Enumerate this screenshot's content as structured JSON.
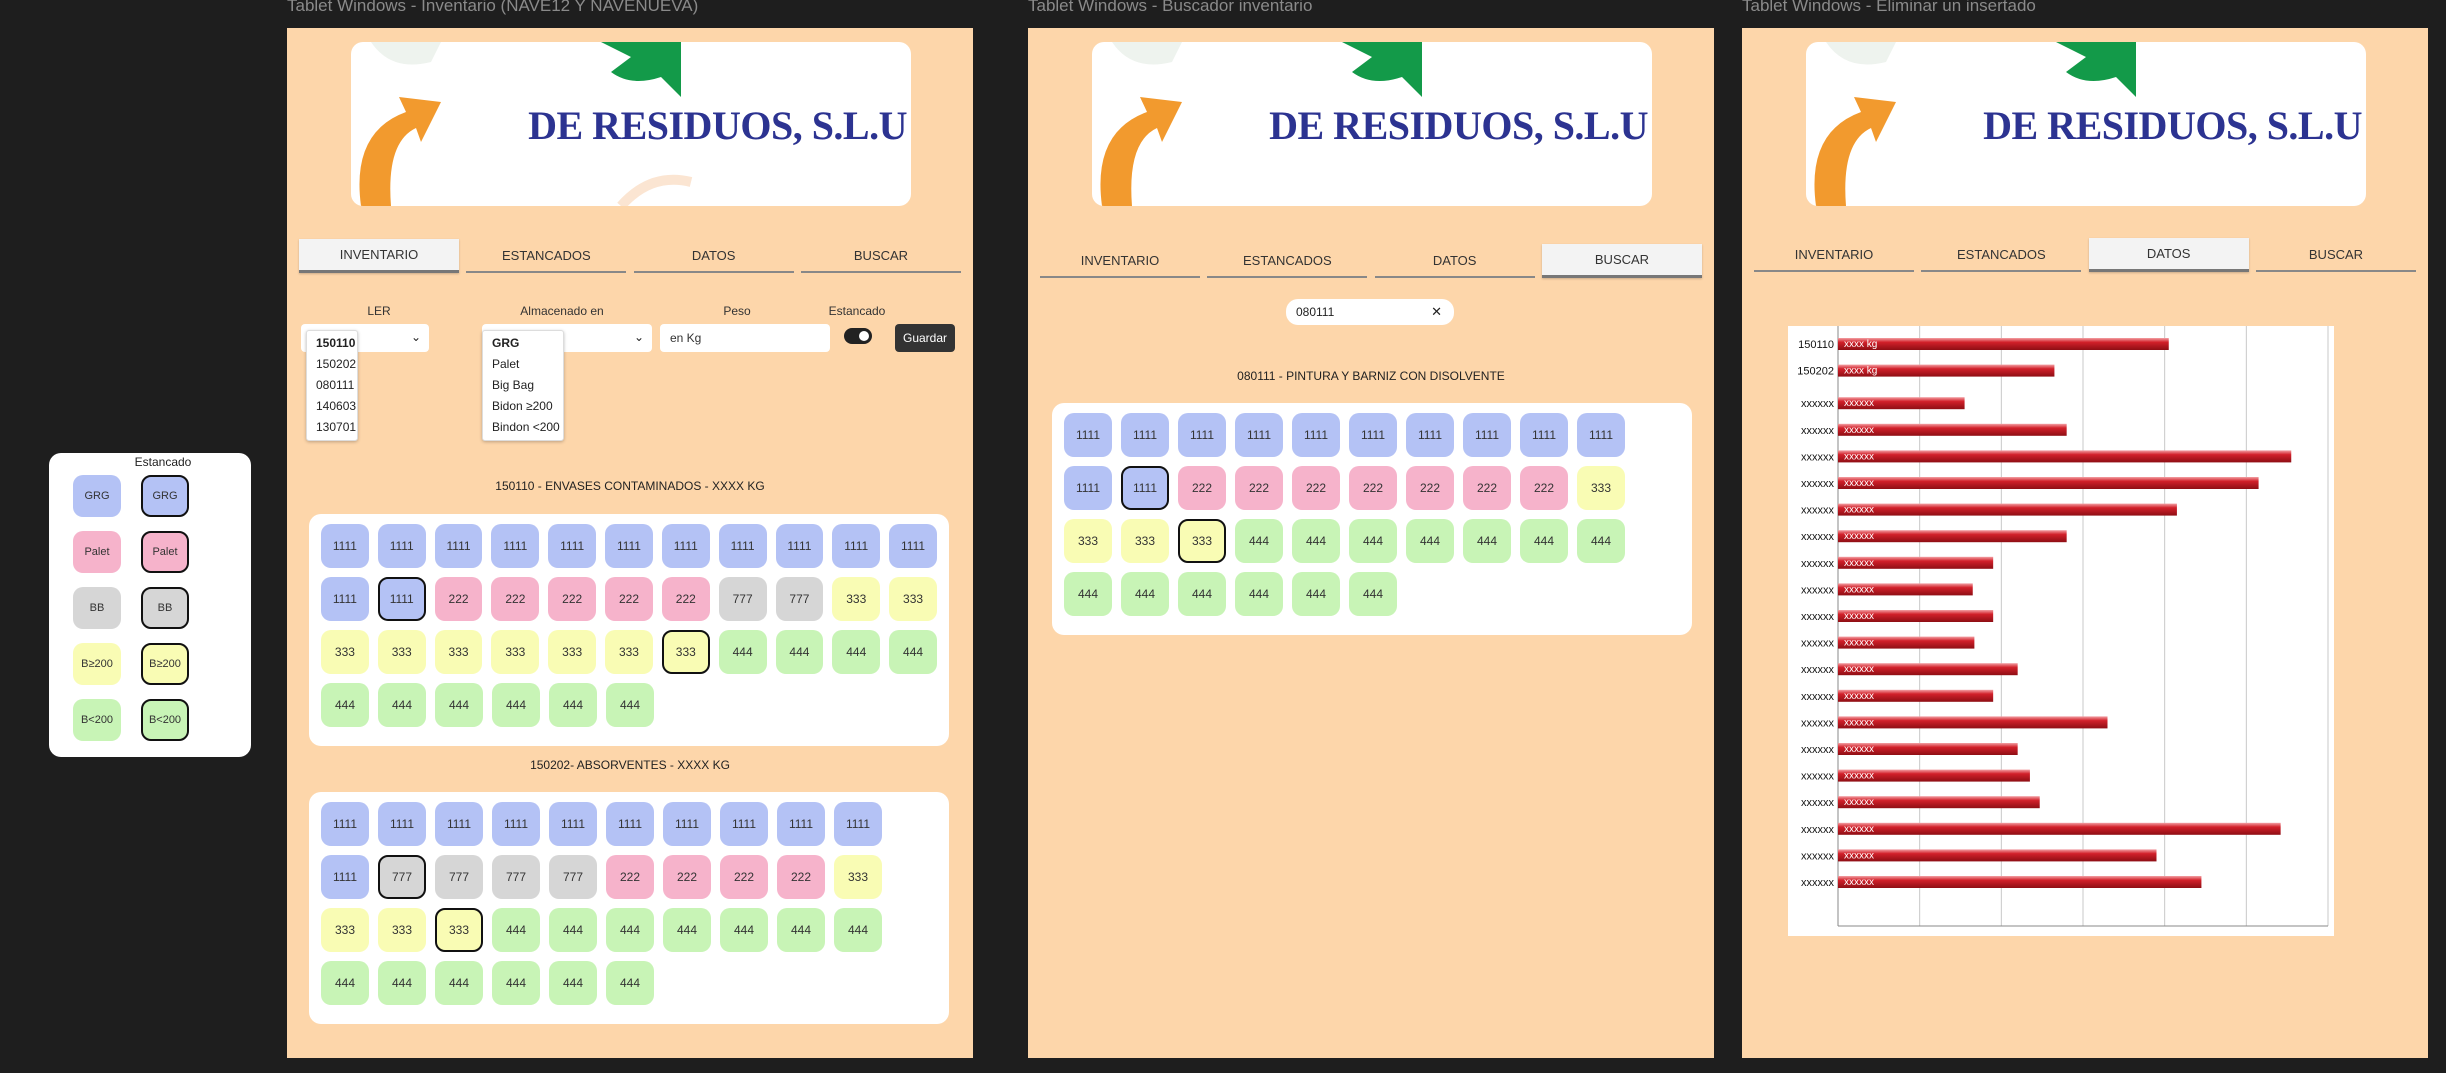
{
  "frames": [
    {
      "title": "Tablet Windows - Inventario (NAVE12 Y NAVENUEVA)"
    },
    {
      "title": "Tablet Windows - Buscador inventario"
    },
    {
      "title": "Tablet Windows - Eliminar un insertado"
    }
  ],
  "logo_text": "DE RESIDUOS, S.L.U",
  "tabs": [
    "INVENTARIO",
    "ESTANCADOS",
    "DATOS",
    "BUSCAR"
  ],
  "form": {
    "ler_label": "LER",
    "almacen_label": "Almacenado en",
    "peso_label": "Peso",
    "estancado_label": "Estancado",
    "peso_placeholder": "en Kg",
    "guardar": "Guardar",
    "ler_options": [
      "150110",
      "150202",
      "080111",
      "140603",
      "130701"
    ],
    "almacen_options": [
      "GRG",
      "Palet",
      "Big Bag",
      "Bidon ≥200",
      "Bindon <200"
    ]
  },
  "legend": {
    "title": "Estancado",
    "rows": [
      [
        "GRG",
        "GRG"
      ],
      [
        "Palet",
        "Palet"
      ],
      [
        "BB",
        "BB"
      ],
      [
        "B≥200",
        "B≥200"
      ],
      [
        "B<200",
        "B<200"
      ]
    ]
  },
  "inventory": {
    "sec1_title": "150110 - ENVASES CONTAMINADOS - XXXX KG",
    "sec1": [
      [
        [
          "1111",
          "b"
        ],
        [
          "1111",
          "b"
        ],
        [
          "1111",
          "b"
        ],
        [
          "1111",
          "b"
        ],
        [
          "1111",
          "b"
        ],
        [
          "1111",
          "b"
        ],
        [
          "1111",
          "b"
        ],
        [
          "1111",
          "b"
        ],
        [
          "1111",
          "b"
        ],
        [
          "1111",
          "b"
        ],
        [
          "1111",
          "b"
        ]
      ],
      [
        [
          "1111",
          "b"
        ],
        [
          "1111",
          "b",
          1
        ],
        [
          "222",
          "p"
        ],
        [
          "222",
          "p"
        ],
        [
          "222",
          "p"
        ],
        [
          "222",
          "p"
        ],
        [
          "222",
          "p"
        ],
        [
          "777",
          "g"
        ],
        [
          "777",
          "g"
        ],
        [
          "333",
          "y"
        ],
        [
          "333",
          "y"
        ]
      ],
      [
        [
          "333",
          "y"
        ],
        [
          "333",
          "y"
        ],
        [
          "333",
          "y"
        ],
        [
          "333",
          "y"
        ],
        [
          "333",
          "y"
        ],
        [
          "333",
          "y"
        ],
        [
          "333",
          "y",
          1
        ],
        [
          "444",
          "gr"
        ],
        [
          "444",
          "gr"
        ],
        [
          "444",
          "gr"
        ],
        [
          "444",
          "gr"
        ]
      ],
      [
        [
          "444",
          "gr"
        ],
        [
          "444",
          "gr"
        ],
        [
          "444",
          "gr"
        ],
        [
          "444",
          "gr"
        ],
        [
          "444",
          "gr"
        ],
        [
          "444",
          "gr"
        ]
      ]
    ],
    "sec2_title": "150202- ABSORVENTES - XXXX KG",
    "sec2": [
      [
        [
          "1111",
          "b"
        ],
        [
          "1111",
          "b"
        ],
        [
          "1111",
          "b"
        ],
        [
          "1111",
          "b"
        ],
        [
          "1111",
          "b"
        ],
        [
          "1111",
          "b"
        ],
        [
          "1111",
          "b"
        ],
        [
          "1111",
          "b"
        ],
        [
          "1111",
          "b"
        ],
        [
          "1111",
          "b"
        ]
      ],
      [
        [
          "1111",
          "b"
        ],
        [
          "777",
          "g",
          1
        ],
        [
          "777",
          "g"
        ],
        [
          "777",
          "g"
        ],
        [
          "777",
          "g"
        ],
        [
          "222",
          "p"
        ],
        [
          "222",
          "p"
        ],
        [
          "222",
          "p"
        ],
        [
          "222",
          "p"
        ],
        [
          "333",
          "y"
        ]
      ],
      [
        [
          "333",
          "y"
        ],
        [
          "333",
          "y"
        ],
        [
          "333",
          "y",
          1
        ],
        [
          "444",
          "gr"
        ],
        [
          "444",
          "gr"
        ],
        [
          "444",
          "gr"
        ],
        [
          "444",
          "gr"
        ],
        [
          "444",
          "gr"
        ],
        [
          "444",
          "gr"
        ],
        [
          "444",
          "gr"
        ]
      ],
      [
        [
          "444",
          "gr"
        ],
        [
          "444",
          "gr"
        ],
        [
          "444",
          "gr"
        ],
        [
          "444",
          "gr"
        ],
        [
          "444",
          "gr"
        ],
        [
          "444",
          "gr"
        ]
      ]
    ]
  },
  "buscador": {
    "search_value": "080111",
    "sec_title": "080111 - PINTURA Y BARNIZ CON DISOLVENTE",
    "rows": [
      [
        [
          "1111",
          "b"
        ],
        [
          "1111",
          "b"
        ],
        [
          "1111",
          "b"
        ],
        [
          "1111",
          "b"
        ],
        [
          "1111",
          "b"
        ],
        [
          "1111",
          "b"
        ],
        [
          "1111",
          "b"
        ],
        [
          "1111",
          "b"
        ],
        [
          "1111",
          "b"
        ],
        [
          "1111",
          "b"
        ]
      ],
      [
        [
          "1111",
          "b"
        ],
        [
          "1111",
          "b",
          1
        ],
        [
          "222",
          "p"
        ],
        [
          "222",
          "p"
        ],
        [
          "222",
          "p"
        ],
        [
          "222",
          "p"
        ],
        [
          "222",
          "p"
        ],
        [
          "222",
          "p"
        ],
        [
          "222",
          "p"
        ],
        [
          "333",
          "y"
        ]
      ],
      [
        [
          "333",
          "y"
        ],
        [
          "333",
          "y"
        ],
        [
          "333",
          "y",
          1
        ],
        [
          "444",
          "gr"
        ],
        [
          "444",
          "gr"
        ],
        [
          "444",
          "gr"
        ],
        [
          "444",
          "gr"
        ],
        [
          "444",
          "gr"
        ],
        [
          "444",
          "gr"
        ],
        [
          "444",
          "gr"
        ]
      ],
      [
        [
          "444",
          "gr"
        ],
        [
          "444",
          "gr"
        ],
        [
          "444",
          "gr"
        ],
        [
          "444",
          "gr"
        ],
        [
          "444",
          "gr"
        ],
        [
          "444",
          "gr"
        ]
      ]
    ]
  },
  "chart_data": {
    "type": "bar",
    "orientation": "horizontal",
    "categories": [
      "150110",
      "150202",
      "xxxxxx",
      "xxxxxx",
      "xxxxxx",
      "xxxxxx",
      "xxxxxx",
      "xxxxxx",
      "xxxxxx",
      "xxxxxx",
      "xxxxxx",
      "xxxxxx",
      "xxxxxx",
      "xxxxxx",
      "xxxxxx",
      "xxxxxx",
      "xxxxxx",
      "xxxxxx",
      "xxxxxx",
      "xxxxxx",
      "xxxxxx"
    ],
    "data_labels": [
      "xxxx kg",
      "xxxx kg",
      "xxxxxx",
      "xxxxxx",
      "xxxxxx",
      "xxxxxx",
      "xxxxxx",
      "xxxxxx",
      "xxxxxx",
      "xxxxxx",
      "xxxxxx",
      "xxxxxx",
      "xxxxxx",
      "xxxxxx",
      "xxxxxx",
      "xxxxxx",
      "xxxxxx",
      "xxxxxx",
      "xxxxxx",
      "xxxxxx",
      "xxxxxx"
    ],
    "values": [
      4.05,
      2.65,
      1.55,
      2.8,
      5.55,
      5.15,
      4.15,
      2.8,
      1.9,
      1.65,
      1.9,
      1.67,
      2.2,
      1.9,
      3.3,
      2.2,
      2.35,
      2.47,
      5.42,
      3.9,
      4.45
    ],
    "xlim": [
      0,
      6
    ],
    "grid": true,
    "bar_color": "#c8151f"
  }
}
